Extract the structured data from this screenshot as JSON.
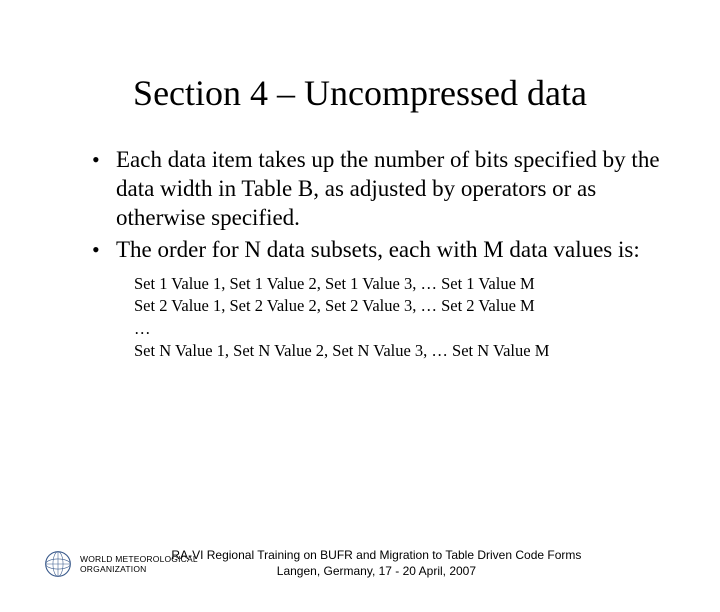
{
  "title": "Section 4 – Uncompressed data",
  "bullets": [
    "Each data item takes up the number of bits specified by the data width in Table B, as adjusted by operators or as otherwise specified.",
    "The order for N data subsets, each with M data values is:"
  ],
  "sublines": [
    "Set 1 Value 1, Set 1 Value 2, Set 1 Value 3, … Set 1 Value M",
    "Set 2 Value 1, Set 2 Value 2, Set 2 Value 3, … Set 2 Value M",
    "…",
    "Set N Value 1, Set N Value 2, Set N Value 3, … Set N Value M"
  ],
  "footer": {
    "org_line1": "WORLD METEOROLOGICAL",
    "org_line2": "ORGANIZATION",
    "right_line1": "RA-VI Regional Training on BUFR and Migration to Table Driven Code Forms",
    "right_line2": "Langen, Germany, 17 - 20 April, 2007"
  }
}
